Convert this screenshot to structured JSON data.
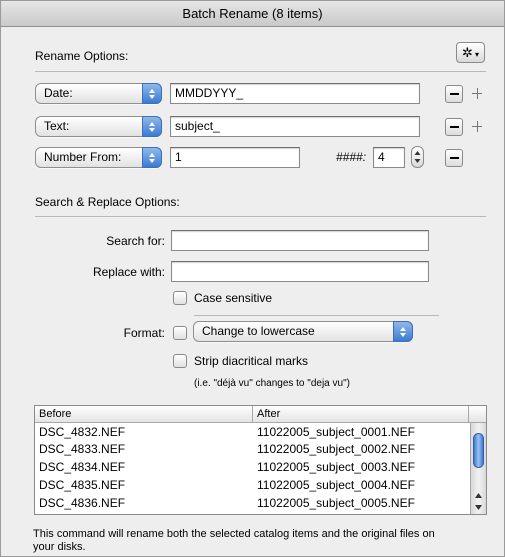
{
  "window": {
    "title": "Batch Rename (8 items)"
  },
  "rename_options": {
    "label": "Rename Options:",
    "gear_menu_caret": "▾",
    "rows": [
      {
        "popup": "Date:",
        "value": "MMDDYYY_"
      },
      {
        "popup": "Text:",
        "value": "subject_"
      },
      {
        "popup": "Number From:",
        "value": "1",
        "digits_label": "####:",
        "digits_value": "4"
      }
    ]
  },
  "search_replace": {
    "label": "Search & Replace Options:",
    "search_label": "Search for:",
    "search_value": "",
    "replace_label": "Replace with:",
    "replace_value": "",
    "case_sensitive_label": "Case sensitive",
    "case_sensitive_checked": false,
    "format_label": "Format:",
    "format_checked": false,
    "format_option": "Change to lowercase",
    "strip_label": "Strip diacritical marks",
    "strip_checked": false,
    "strip_note": "(i.e. \"déjà vu\" changes to \"deja vu\")"
  },
  "preview": {
    "columns": [
      "Before",
      "After"
    ],
    "rows": [
      [
        "DSC_4832.NEF",
        "11022005_subject_0001.NEF"
      ],
      [
        "DSC_4833.NEF",
        "11022005_subject_0002.NEF"
      ],
      [
        "DSC_4834.NEF",
        "11022005_subject_0003.NEF"
      ],
      [
        "DSC_4835.NEF",
        "11022005_subject_0004.NEF"
      ],
      [
        "DSC_4836.NEF",
        "11022005_subject_0005.NEF"
      ]
    ]
  },
  "footer": {
    "line1": "This command will rename both the selected catalog items and the original files on",
    "line2": "your disks."
  },
  "colors": {
    "accent": "#3b7bd5",
    "window_bg": "#eeeeee"
  }
}
